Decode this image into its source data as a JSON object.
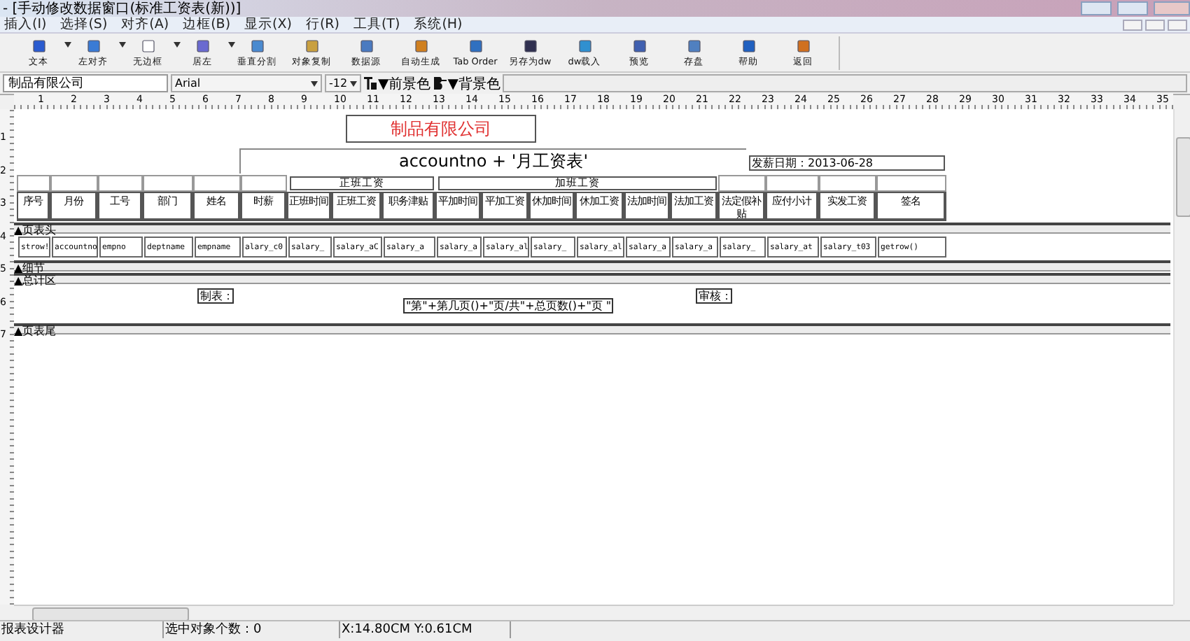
{
  "window": {
    "title": "- [手动修改数据窗口(标准工资表(新))]"
  },
  "menu": [
    "插入(I)",
    "选择(S)",
    "对齐(A)",
    "边框(B)",
    "显示(X)",
    "行(R)",
    "工具(T)",
    "系统(H)"
  ],
  "toolbar": [
    {
      "label": "文本",
      "dropdown": true
    },
    {
      "label": "左对齐",
      "dropdown": true
    },
    {
      "label": "无边框",
      "dropdown": true
    },
    {
      "label": "居左",
      "dropdown": true
    },
    {
      "label": "垂直分割",
      "dropdown": false
    },
    {
      "label": "对象复制",
      "dropdown": false
    },
    {
      "label": "数据源",
      "dropdown": false
    },
    {
      "label": "自动生成",
      "dropdown": false
    },
    {
      "label": "Tab Order",
      "dropdown": false
    },
    {
      "label": "另存为dw",
      "dropdown": false
    },
    {
      "label": "dw载入",
      "dropdown": false
    },
    {
      "label": "预览",
      "dropdown": false
    },
    {
      "label": "存盘",
      "dropdown": false
    },
    {
      "label": "帮助",
      "dropdown": false
    },
    {
      "label": "返回",
      "dropdown": false
    }
  ],
  "format_bar": {
    "text_value": "制品有限公司",
    "font": "Arial",
    "size": "-12",
    "foreground": "▼前景色",
    "background": "▼背景色"
  },
  "ruler": {
    "horizontal": [
      "1",
      "2",
      "3",
      "4",
      "5",
      "6",
      "7",
      "8",
      "9",
      "10",
      "11",
      "12",
      "13",
      "14",
      "15",
      "16",
      "17",
      "18",
      "19",
      "20",
      "21",
      "22",
      "23",
      "24",
      "25",
      "26",
      "27",
      "28",
      "29",
      "30",
      "31",
      "32",
      "33",
      "34",
      "35"
    ],
    "vertical": [
      "1",
      "2",
      "3",
      "4",
      "5",
      "6",
      "7"
    ]
  },
  "report": {
    "company": "制品有限公司",
    "heading": "accountno + '月工资表'",
    "date": "发薪日期：2013-06-28",
    "groups": [
      "正班工资",
      "加班工资"
    ],
    "columns": [
      "序号",
      "月份",
      "工号",
      "部门",
      "姓名",
      "时薪",
      "正班时间",
      "正班工资",
      "职务津贴",
      "平加时间",
      "平加工资",
      "休加时间",
      "休加工资",
      "法加时间",
      "法加工资",
      "法定假补贴",
      "应付小计",
      "实发工资",
      "签名"
    ],
    "fields": [
      "strow!",
      "accountno",
      "empno",
      "deptname",
      "empname",
      "alary_c0",
      "salary_",
      "salary_aC",
      "salary_a",
      "salary_a",
      "salary_al",
      "salary_",
      "salary_al",
      "salary_a",
      "salary_a",
      "salary_",
      "salary_at",
      "salary_t03",
      "getrow()"
    ],
    "bands": [
      "▲页表头",
      "▲细节",
      "▲总计区",
      "▲页表尾"
    ],
    "summary": {
      "maker": "制表：",
      "page": "\"第\"+第几页()+\"页/共\"+总页数()+\"页 \"",
      "checker": "审核："
    }
  },
  "status_bar": [
    "报表设计器",
    "选中对象个数：0",
    "X:14.80CM  Y:0.61CM"
  ]
}
